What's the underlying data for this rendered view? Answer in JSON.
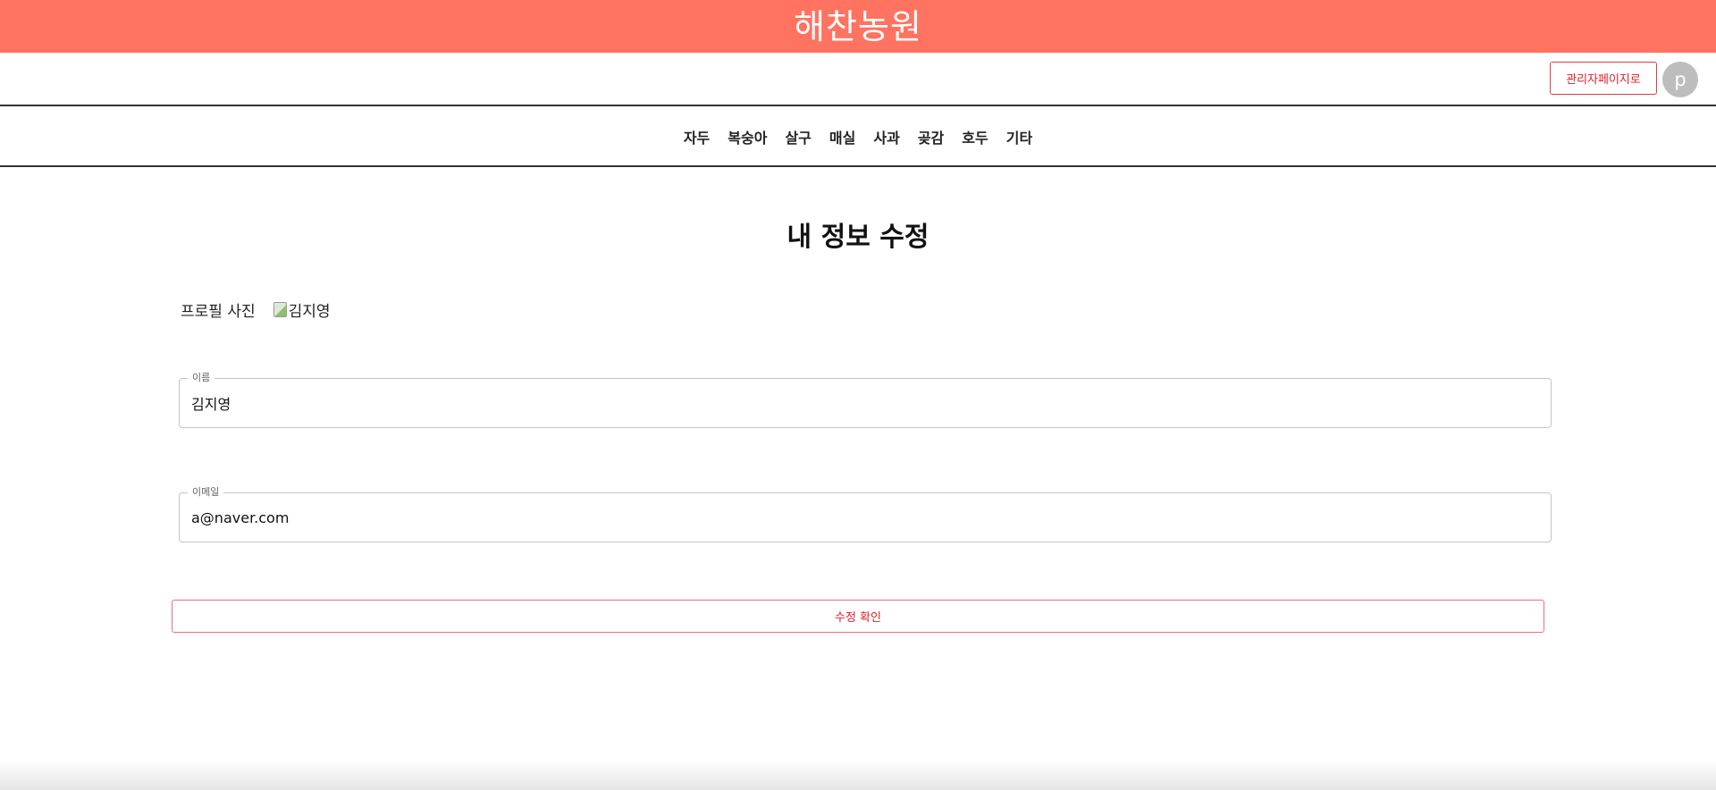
{
  "brand": {
    "title": "해찬농원"
  },
  "util": {
    "admin_button_label": "관리자페이지로",
    "avatar_initial": "p"
  },
  "nav": {
    "categories": [
      "자두",
      "복숭아",
      "살구",
      "매실",
      "사과",
      "곶감",
      "호두",
      "기타"
    ]
  },
  "page": {
    "title": "내 정보 수정"
  },
  "profile": {
    "label": "프로필 사진",
    "image_alt": "김지영"
  },
  "form": {
    "name": {
      "legend": "이름",
      "value": "김지영"
    },
    "email": {
      "legend": "이메일",
      "value": "a@naver.com"
    },
    "submit_label": "수정 확인"
  },
  "colors": {
    "brand_bar": "#ff7360",
    "accent_red": "#d9232d"
  }
}
